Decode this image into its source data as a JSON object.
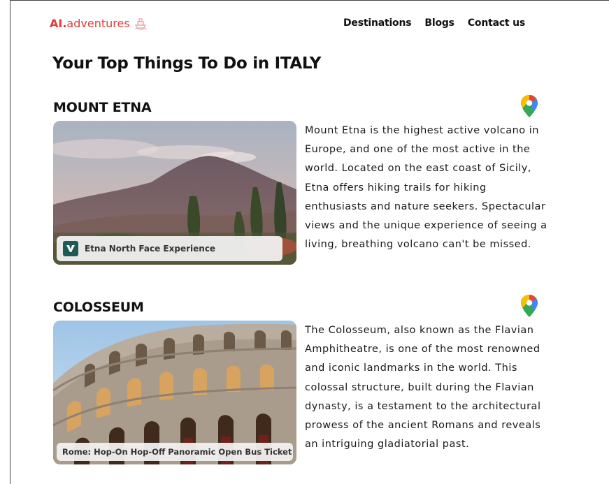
{
  "header": {
    "logo_ai": "AI.",
    "logo_rest": "adventures",
    "logo_icon": "ship-icon",
    "nav": [
      "Destinations",
      "Blogs",
      "Contact us"
    ]
  },
  "page": {
    "title": "Your Top Things To Do in ITALY"
  },
  "attractions": [
    {
      "title": "MOUNT ETNA",
      "map_icon": "google-maps-pin-icon",
      "caption": "Etna North Face Experience",
      "caption_icon": "viator-icon",
      "description": "Mount Etna is the highest active volcano in Europe, and one of the most active in the world. Located on the east coast of Sicily, Etna offers hiking trails for hiking enthusiasts and nature seekers. Spectacular views and the unique experience of seeing a living, breathing volcano can't be missed."
    },
    {
      "title": "COLOSSEUM",
      "map_icon": "google-maps-pin-icon",
      "caption": "Rome: Hop-On Hop-Off Panoramic Open Bus Ticket",
      "description": "The Colosseum, also known as the Flavian Amphitheatre, is one of the most renowned and iconic landmarks in the world. This colossal structure, built during the Flavian dynasty, is a testament to the architectural prowess of the ancient Romans and reveals an intriguing gladiatorial past."
    }
  ],
  "colors": {
    "brand": "#e23b3b",
    "viator": "#1e5a55"
  }
}
